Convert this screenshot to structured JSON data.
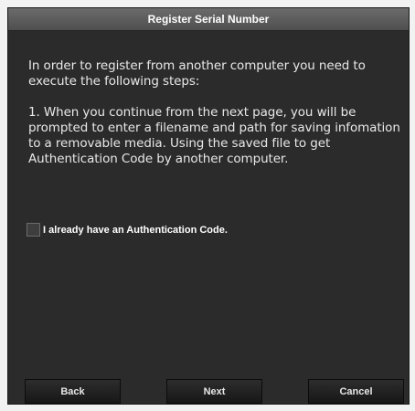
{
  "dialog": {
    "title": "Register Serial Number",
    "intro": "In order to register from another computer you need to execute the following steps:",
    "step1": "1.  When you continue from the next page, you will be prompted to enter a filename and path for saving infomation to a removable media. Using the saved file to get Authentication Code by another computer.",
    "checkbox": {
      "label": "I already have an Authentication Code.",
      "checked": false
    },
    "buttons": {
      "back": "Back",
      "next": "Next",
      "cancel": "Cancel"
    }
  },
  "colors": {
    "background": "#2b2b2b",
    "titlebar": "#5a5a5a",
    "text": "#e8e8e8"
  }
}
